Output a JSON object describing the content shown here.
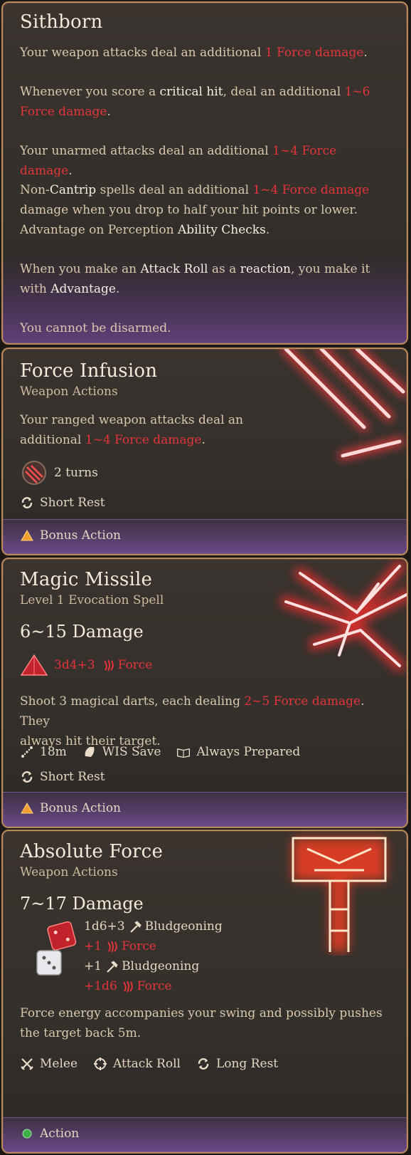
{
  "cards": [
    {
      "title": "Sithborn",
      "p1": {
        "a": "Your weapon attacks deal an additional ",
        "r": "1 Force damage",
        "b": "."
      },
      "p2": {
        "a": "Whenever you score a ",
        "h": "critical hit",
        "b": ", deal an additional ",
        "r1": "1~6",
        "r2": "Force damage",
        "c": "."
      },
      "p3": {
        "a": "Your unarmed attacks deal an additional ",
        "r": "1~4 Force damage",
        "b": "."
      },
      "p4": {
        "a": "Non-",
        "h1": "Cantrip",
        "b": " spells deal an additional ",
        "r": "1~4 Force damage",
        "c": "damage when you drop to half your hit points or lower.",
        "d": "Advantage on Perception ",
        "h2": "Ability Checks",
        "e": "."
      },
      "p5": {
        "a": "When you make an ",
        "h1": "Attack Roll",
        "b": " as a ",
        "h2": "reaction",
        "c": ", you make it",
        "d": "with ",
        "h3": "Advantage",
        "e": "."
      },
      "p6": "You cannot be disarmed."
    },
    {
      "title": "Force Infusion",
      "subtitle": "Weapon Actions",
      "desc": {
        "a": "Your ranged weapon attacks deal an",
        "b": "additional ",
        "r": "1~4 Force damage",
        "c": "."
      },
      "duration": "2 turns",
      "recharge": "Short Rest",
      "action": "Bonus Action"
    },
    {
      "title": "Magic Missile",
      "subtitle": "Level 1 Evocation Spell",
      "damage": "6~15 Damage",
      "dice": "3d4+3",
      "damage_type": "Force",
      "desc": {
        "a": "Shoot 3 magical darts, each dealing ",
        "r": "2~5 Force damage",
        "b": ". They",
        "c": "always hit their target."
      },
      "range": "18m",
      "save": "WIS Save",
      "prepared": "Always Prepared",
      "recharge": "Short Rest",
      "action": "Bonus Action"
    },
    {
      "title": "Absolute Force",
      "subtitle": "Weapon Actions",
      "damage": "7~17 Damage",
      "lines": [
        {
          "amount": "1d6+3",
          "type": "Bludgeoning",
          "red": false
        },
        {
          "amount": "+1",
          "type": "Force",
          "red": true
        },
        {
          "amount": "+1",
          "type": "Bludgeoning",
          "red": false
        },
        {
          "amount": "+1d6",
          "type": "Force",
          "red": true
        }
      ],
      "desc": {
        "a": "Force energy accompanies your swing and possibly pushes",
        "b": "the target back 5m."
      },
      "melee": "Melee",
      "attack": "Attack Roll",
      "recharge": "Long Rest",
      "action": "Action"
    }
  ],
  "colors": {
    "accent_red": "#e3343a",
    "border": "#b78a5e",
    "action_green": "#3fae4a",
    "bonus_orange": "#f0a030"
  }
}
